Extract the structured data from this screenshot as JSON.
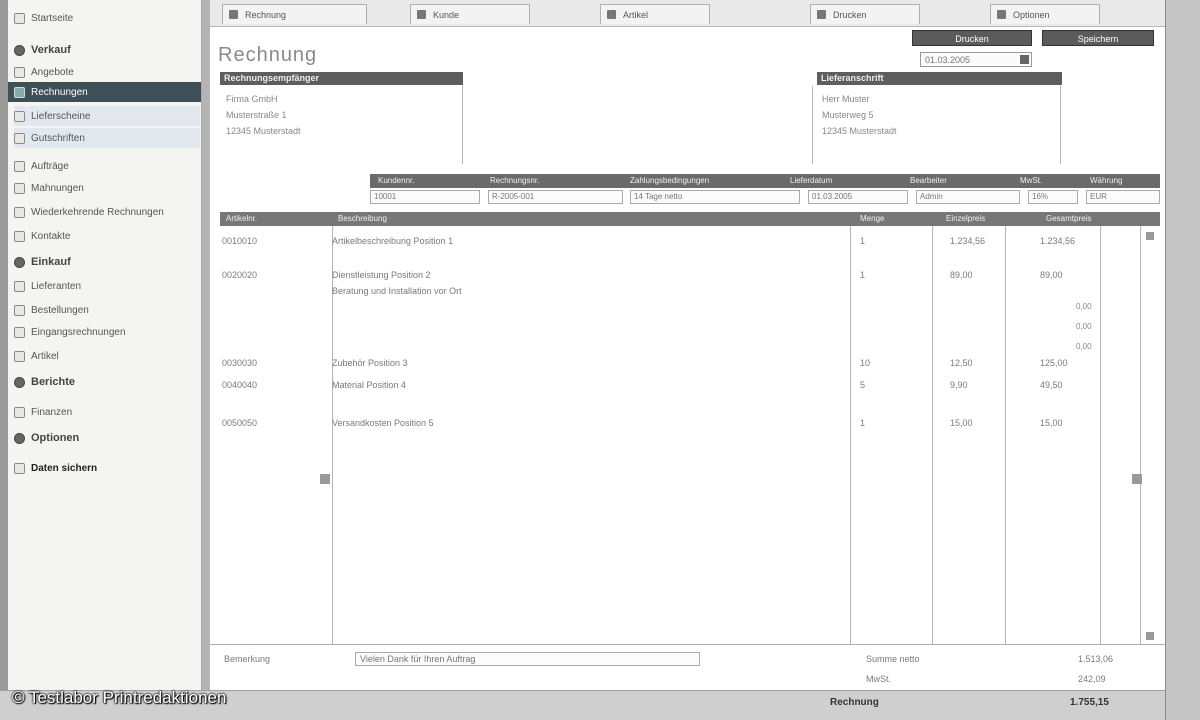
{
  "copyright": "© Testlabor Printredaktionen",
  "sidebar": {
    "items": [
      {
        "label": "Startseite",
        "kind": "normal"
      },
      {
        "label": "Verkauf",
        "kind": "section"
      },
      {
        "label": "Angebote",
        "kind": "normal"
      },
      {
        "label": "Rechnungen",
        "kind": "active"
      },
      {
        "label": "Lieferscheine",
        "kind": "hover"
      },
      {
        "label": "Gutschriften",
        "kind": "hover"
      },
      {
        "label": "Aufträge",
        "kind": "normal"
      },
      {
        "label": "Mahnungen",
        "kind": "normal"
      },
      {
        "label": "Wiederkehrende Rechnungen",
        "kind": "normal"
      },
      {
        "label": "Kontakte",
        "kind": "normal"
      },
      {
        "label": "Einkauf",
        "kind": "section"
      },
      {
        "label": "Lieferanten",
        "kind": "normal"
      },
      {
        "label": "Bestellungen",
        "kind": "normal"
      },
      {
        "label": "Eingangsrechnungen",
        "kind": "normal"
      },
      {
        "label": "Artikel",
        "kind": "normal"
      },
      {
        "label": "Berichte",
        "kind": "section"
      },
      {
        "label": "Finanzen",
        "kind": "normal"
      },
      {
        "label": "Optionen",
        "kind": "section"
      },
      {
        "label": "Daten sichern",
        "kind": "bold"
      }
    ]
  },
  "tabs": [
    {
      "label": "Rechnung"
    },
    {
      "label": "Kunde"
    },
    {
      "label": "Artikel"
    },
    {
      "label": "Drucken"
    },
    {
      "label": "Optionen"
    }
  ],
  "doc": {
    "title": "Rechnung",
    "print_button": "Drucken",
    "save_button": "Speichern",
    "date": "01.03.2005"
  },
  "sender": {
    "header": "Rechnungsempfänger",
    "lines": [
      "Firma GmbH",
      "Musterstraße 1",
      "12345 Musterstadt"
    ]
  },
  "recipient": {
    "header": "Lieferanschrift",
    "lines": [
      "Herr Muster",
      "Musterweg 5",
      "12345 Musterstadt"
    ]
  },
  "options": {
    "labels": [
      "Kundennr.",
      "Rechnungsnr.",
      "Zahlungsbedingungen",
      "Lieferdatum",
      "Bearbeiter",
      "MwSt.",
      "Währung"
    ],
    "fields": [
      "10001",
      "R-2005-001",
      "14 Tage netto",
      "01.03.2005",
      "Admin",
      "16%",
      "EUR"
    ]
  },
  "grid": {
    "headers": [
      "Artikelnr.",
      "Beschreibung",
      "Menge",
      "Einzelpreis",
      "Gesamtpreis"
    ],
    "rows": [
      {
        "nr": "0010010",
        "desc": "Artikelbeschreibung Position 1",
        "qty": "1",
        "price": "1.234,56",
        "total": "1.234,56"
      },
      {
        "nr": "0020020",
        "desc": "Dienstleistung Position 2",
        "desc2": "Beratung und Installation vor Ort",
        "qty": "1",
        "price": "89,00",
        "total": "89,00"
      },
      {
        "nr": "0030030",
        "desc": "Zubehör Position 3",
        "qty": "10",
        "price": "12,50",
        "total": "125,00"
      },
      {
        "nr": "0040040",
        "desc": "Material Position 4",
        "qty": "5",
        "price": "9,90",
        "total": "49,50"
      },
      {
        "nr": "0050050",
        "desc": "Versandkosten Position 5",
        "qty": "1",
        "price": "15,00",
        "total": "15,00"
      }
    ],
    "sub_values": [
      "0,00",
      "0,00",
      "0,00"
    ]
  },
  "footer": {
    "note_label": "Bemerkung",
    "note_value": "Vielen Dank für Ihren Auftrag",
    "net_label": "Summe netto",
    "net_value": "1.513,06",
    "vat_label": "MwSt.",
    "vat_value": "242,09"
  },
  "status": {
    "center": "Rechnung",
    "right": "1.755,15"
  }
}
